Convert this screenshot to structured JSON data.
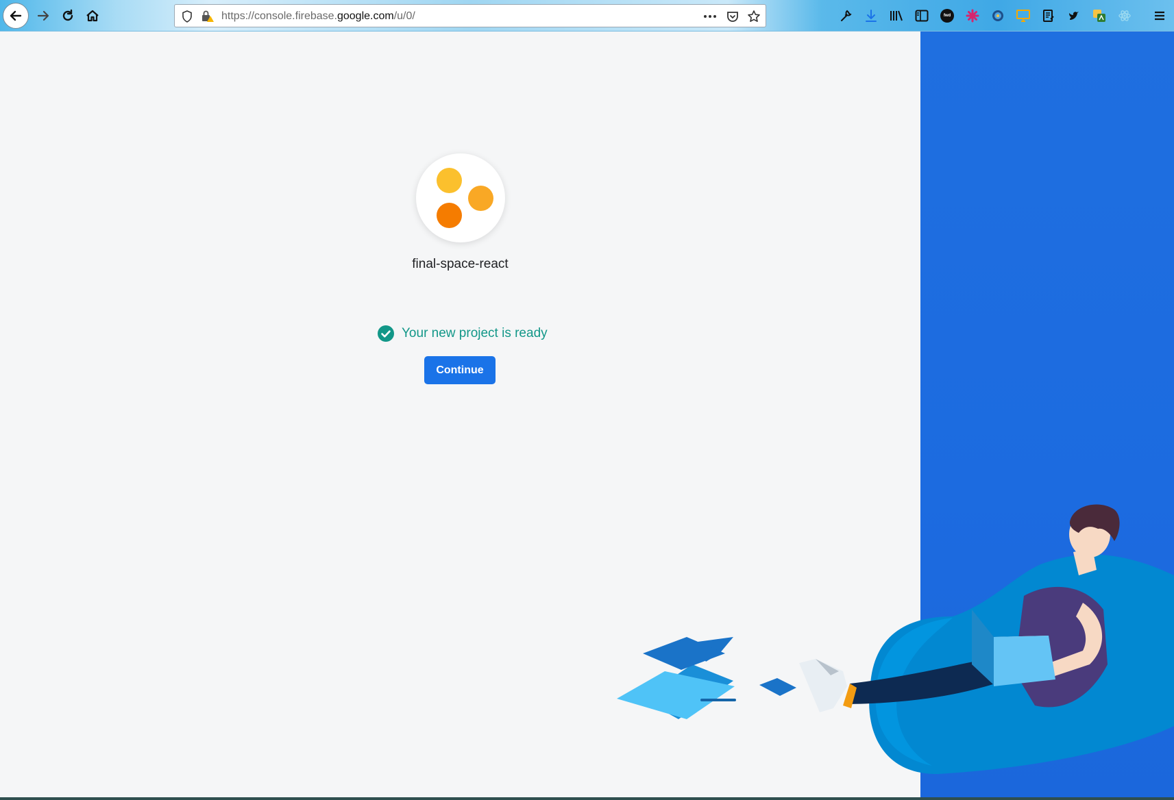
{
  "browser": {
    "url_prefix": "https://console.firebase.",
    "url_domain": "google.com",
    "url_path": "/u/0/",
    "icons": {
      "back": "back-arrow-icon",
      "forward": "forward-arrow-icon",
      "reload": "reload-icon",
      "home": "home-icon",
      "tracking": "shield-icon",
      "lock": "lock-warning-icon",
      "more": "more-icon",
      "pocket": "pocket-icon",
      "bookmark": "star-icon",
      "menu": "hamburger-menu-icon"
    },
    "extensions": [
      "wrench-icon",
      "download-icon",
      "library-icon",
      "sidebar-icon",
      "fwd-icon",
      "asterisk-icon",
      "globe-icon",
      "monitor-icon",
      "notes-icon",
      "bird-icon",
      "translate-icon",
      "react-icon"
    ],
    "extension_text": "fwd"
  },
  "project": {
    "name": "final-space-react",
    "dot_colors": [
      "#fbc02d",
      "#f9a825",
      "#f57c00"
    ]
  },
  "status": {
    "message": "Your new project is ready",
    "color": "#129788"
  },
  "actions": {
    "continue_label": "Continue",
    "accent": "#1a73e8"
  },
  "panel": {
    "color": "#1c6be0"
  }
}
